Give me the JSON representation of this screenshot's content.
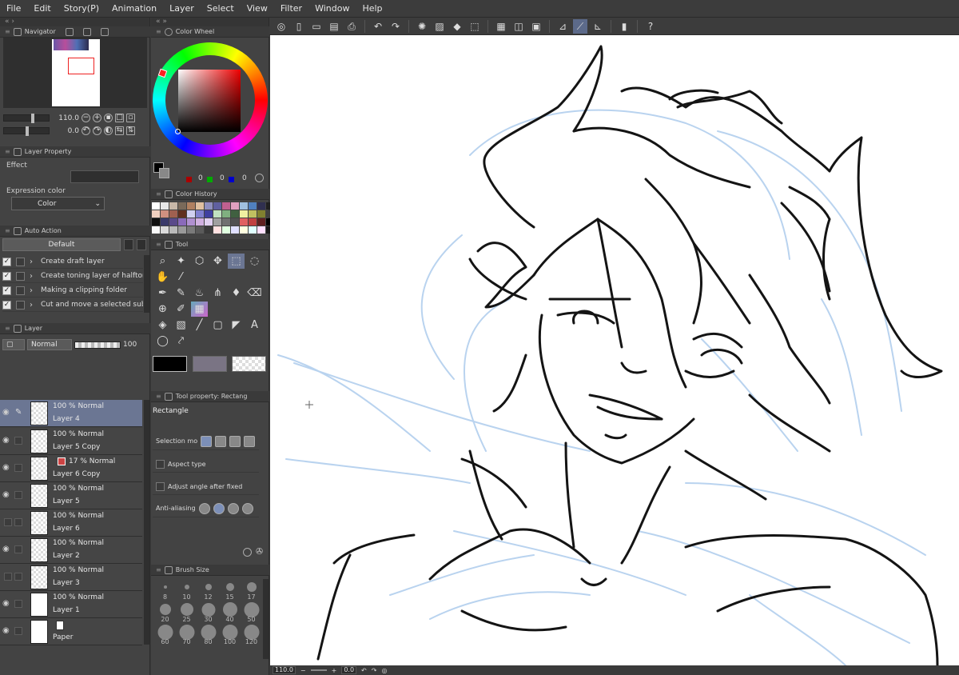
{
  "menu": [
    "File",
    "Edit",
    "Story(P)",
    "Animation",
    "Layer",
    "Select",
    "View",
    "Filter",
    "Window",
    "Help"
  ],
  "navigator": {
    "title": "Navigator",
    "zoom": "110.0",
    "rotation": "0.0"
  },
  "layer_property": {
    "title": "Layer Property",
    "effect_label": "Effect",
    "expression_label": "Expression color",
    "expression_value": "Color"
  },
  "auto_action": {
    "title": "Auto Action",
    "set": "Default",
    "items": [
      "Create draft layer",
      "Create toning layer of halftone",
      "Making a clipping folder",
      "Cut and move a selected subj"
    ]
  },
  "layer_panel": {
    "title": "Layer",
    "blend_mode": "Normal",
    "opacity": "100",
    "layers": [
      {
        "mode": "100 % Normal",
        "name": "Layer 4",
        "selected": true
      },
      {
        "mode": "100 % Normal",
        "name": "Layer 5 Copy"
      },
      {
        "mode": "17 % Normal",
        "name": "Layer 6 Copy"
      },
      {
        "mode": "100 % Normal",
        "name": "Layer 5"
      },
      {
        "mode": "100 % Normal",
        "name": "Layer 6"
      },
      {
        "mode": "100 % Normal",
        "name": "Layer 2"
      },
      {
        "mode": "100 % Normal",
        "name": "Layer 3"
      },
      {
        "mode": "100 % Normal",
        "name": "Layer 1"
      },
      {
        "mode": "",
        "name": "Paper"
      }
    ]
  },
  "color_wheel": {
    "title": "Color Wheel",
    "r": "0",
    "g": "0",
    "b": "0"
  },
  "color_history": {
    "title": "Color History",
    "swatches": [
      "#ffffff",
      "#e8e8e8",
      "#c8b8a8",
      "#7a6a5a",
      "#b08060",
      "#e0c0a0",
      "#9090c0",
      "#6060a0",
      "#c06090",
      "#e0a0c0",
      "#a0c0e0",
      "#5080c0",
      "#303050",
      "#202020",
      "#f0d0c0",
      "#d09080",
      "#a06050",
      "#603020",
      "#d0d0f0",
      "#8080d0",
      "#4040a0",
      "#c0e0c0",
      "#80b080",
      "#406040",
      "#f0f0a0",
      "#c0c060",
      "#808030",
      "#404040",
      "#101010",
      "#3a3a6a",
      "#5a4a8a",
      "#8a6aba",
      "#b090d0",
      "#d0b0e0",
      "#e0d0f0",
      "#a0a0a0",
      "#707070",
      "#505050",
      "#e06060",
      "#c04040",
      "#602020",
      "#000000",
      "#fafafa",
      "#dadada",
      "#bababa",
      "#9a9a9a",
      "#7a7a7a",
      "#5a5a5a",
      "#3a3a3a",
      "#ffe0e0",
      "#e0ffe0",
      "#e0e0ff",
      "#ffffe0",
      "#e0ffff",
      "#ffe0ff",
      "#1a1a1a"
    ]
  },
  "tool": {
    "title": "Tool"
  },
  "tool_property": {
    "title": "Tool property: Rectang",
    "tool_name": "Rectangle",
    "selection_mode": "Selection mod",
    "aspect_type": "Aspect type",
    "adjust_angle": "Adjust angle after fixed",
    "anti_aliasing": "Anti-aliasing"
  },
  "brush_size": {
    "title": "Brush Size",
    "sizes": [
      "8",
      "10",
      "12",
      "15",
      "17",
      "20",
      "25",
      "30",
      "40",
      "50",
      "60",
      "70",
      "80",
      "100",
      "120"
    ]
  },
  "status": {
    "zoom": "110.0",
    "angle": "0.0"
  },
  "colors": {
    "panel_bg": "#434343",
    "selected_layer": "#6b7693",
    "sketch_blue": "#b9d3ef",
    "ink": "#141414"
  }
}
